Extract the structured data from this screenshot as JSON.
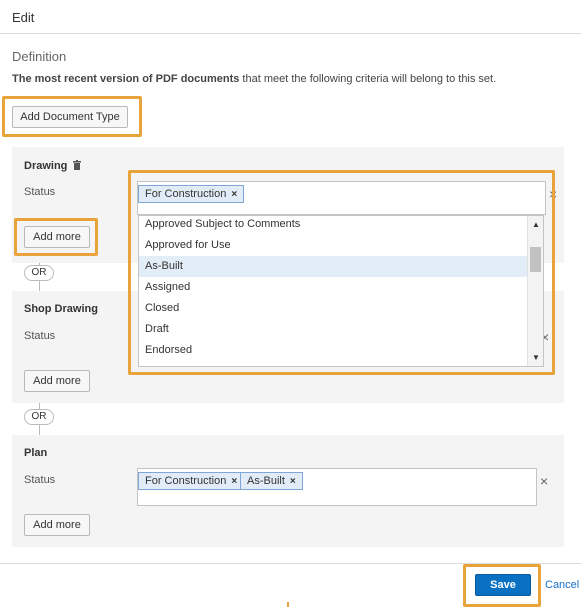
{
  "header": {
    "title": "Edit"
  },
  "definition": {
    "title": "Definition",
    "desc_bold": "The most recent version of PDF documents",
    "desc_rest": " that meet the following criteria will belong to this set.",
    "add_type_label": "Add Document Type"
  },
  "groups": [
    {
      "title": "Drawing",
      "status_label": "Status",
      "tags": [
        "For Construction"
      ],
      "add_more_label": "Add more",
      "dropdown": {
        "options": [
          "Approved Subject to Comments",
          "Approved for Use",
          "As-Built",
          "Assigned",
          "Closed",
          "Draft",
          "Endorsed"
        ],
        "highlighted": "As-Built"
      }
    },
    {
      "title": "Shop Drawing",
      "status_label": "Status",
      "tags": [],
      "add_more_label": "Add more"
    },
    {
      "title": "Plan",
      "status_label": "Status",
      "tags": [
        "For Construction",
        "As-Built"
      ],
      "add_more_label": "Add more"
    }
  ],
  "or_label": "OR",
  "tag_remove_glyph": "×",
  "clear_glyph": "×",
  "footer": {
    "save_label": "Save",
    "cancel_label": "Cancel"
  },
  "colors": {
    "accent": "#0a70c2",
    "highlight": "#e8a33a",
    "tag_bg": "#e2ecf8",
    "panel_bg": "#f4f4f4"
  }
}
